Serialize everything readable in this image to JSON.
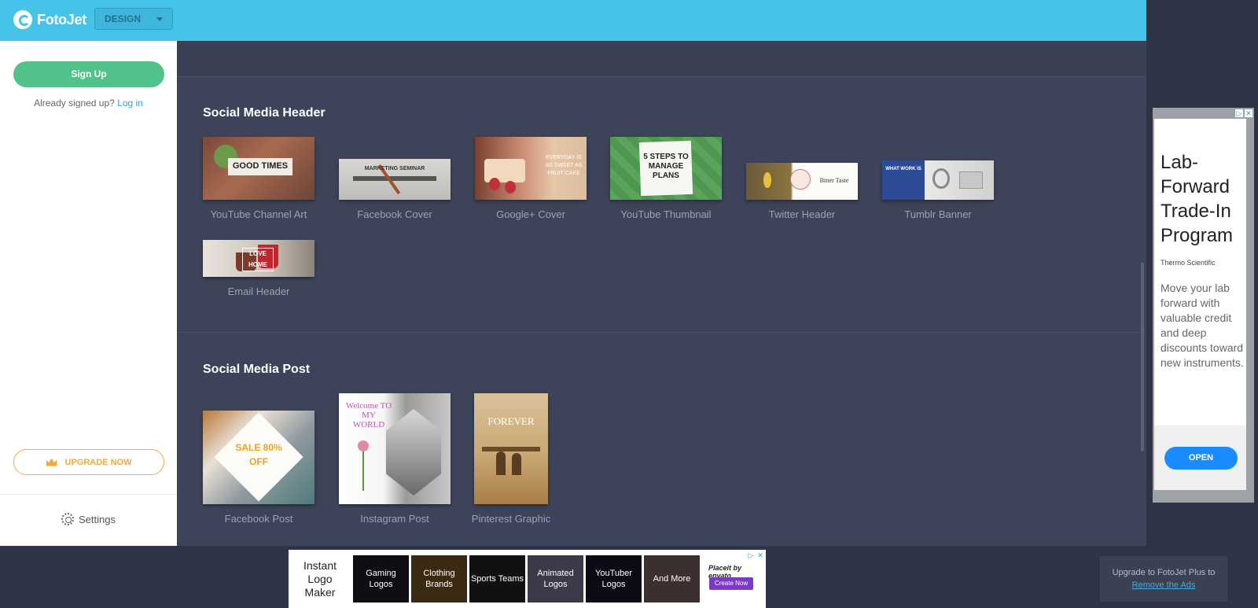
{
  "app": {
    "name": "FotoJet",
    "mode_select": "DESIGN"
  },
  "sidebar": {
    "signup_label": "Sign Up",
    "already_text": "Already signed up?",
    "login_label": "Log in",
    "upgrade_label": "UPGRADE NOW",
    "settings_label": "Settings"
  },
  "sections": {
    "header": {
      "title": "Social Media Header",
      "items": [
        {
          "label": "YouTube Channel Art",
          "thumb_text": "GOOD TIMES"
        },
        {
          "label": "Facebook Cover",
          "thumb_text": "MARKETING SEMINAR"
        },
        {
          "label": "Google+ Cover",
          "thumb_text": "EVERYDAY IS AS SWEET AS FRUIT CAKE"
        },
        {
          "label": "YouTube Thumbnail",
          "thumb_text": "5 STEPS TO MANAGE PLANS"
        },
        {
          "label": "Twitter Header",
          "thumb_text": "Bitter Taste"
        },
        {
          "label": "Tumblr Banner",
          "thumb_text": "WHAT WORK IS"
        },
        {
          "label": "Email Header",
          "thumb_text": "LOVE HOME"
        }
      ]
    },
    "post": {
      "title": "Social Media Post",
      "items": [
        {
          "label": "Facebook Post",
          "thumb_text": "SALE 80% OFF"
        },
        {
          "label": "Instagram Post",
          "thumb_text": "Welcome TO MY WORLD"
        },
        {
          "label": "Pinterest Graphic",
          "thumb_text": "FOREVER"
        }
      ]
    }
  },
  "right_ad": {
    "title": "Lab-Forward Trade-In Program",
    "brand": "Thermo Scientific",
    "body": "Move your lab forward with valuable credit and deep discounts toward new instruments.",
    "button": "OPEN"
  },
  "bottom_ad": {
    "title": "Instant Logo Maker",
    "tiles": [
      "Gaming Logos",
      "Clothing Brands",
      "Sports Teams",
      "Animated Logos",
      "YouTuber Logos",
      "And More"
    ],
    "placeit": "Placeit by envato",
    "create": "Create Now"
  },
  "remove_ads": {
    "text": "Upgrade to FotoJet Plus to",
    "link": "Remove the Ads"
  },
  "colors": {
    "topbar": "#45c3e8",
    "signup": "#52c28b",
    "upgrade": "#f2a93b",
    "main_bg": "#3d4459"
  }
}
